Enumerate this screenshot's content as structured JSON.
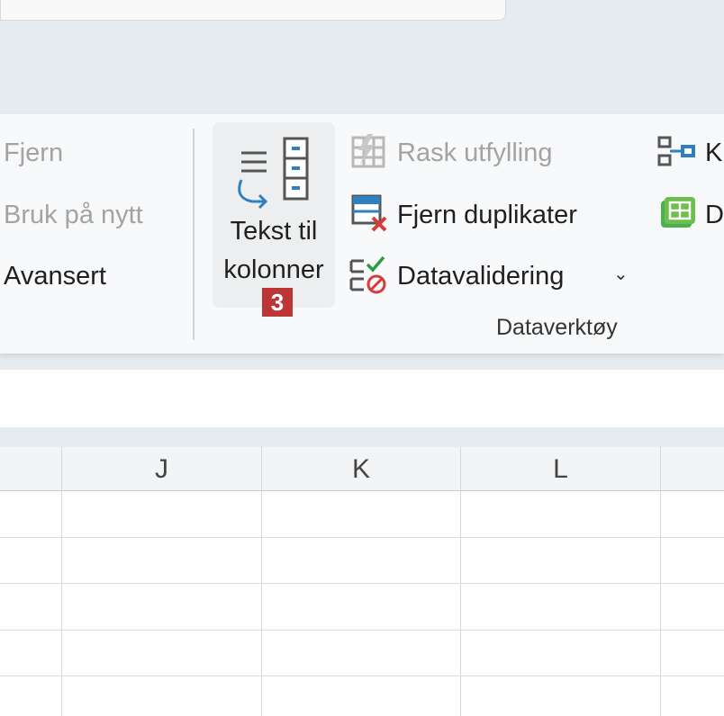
{
  "ribbon": {
    "left_items": [
      "Fjern",
      "Bruk på nytt",
      "Avansert"
    ],
    "big_button": {
      "line1": "Tekst til",
      "line2": "kolonner",
      "badge": "3"
    },
    "tools": {
      "flash_fill": "Rask utfylling",
      "remove_duplicates": "Fjern duplikater",
      "data_validation": "Datavalidering"
    },
    "right_items": [
      "K",
      "D"
    ],
    "group_label": "Dataverktøy"
  },
  "grid": {
    "columns": [
      "J",
      "K",
      "L"
    ]
  },
  "colors": {
    "badge": "#bc3638",
    "accent_blue": "#2f7fc1",
    "accent_red": "#d83b3b",
    "accent_green": "#2e9a47"
  }
}
